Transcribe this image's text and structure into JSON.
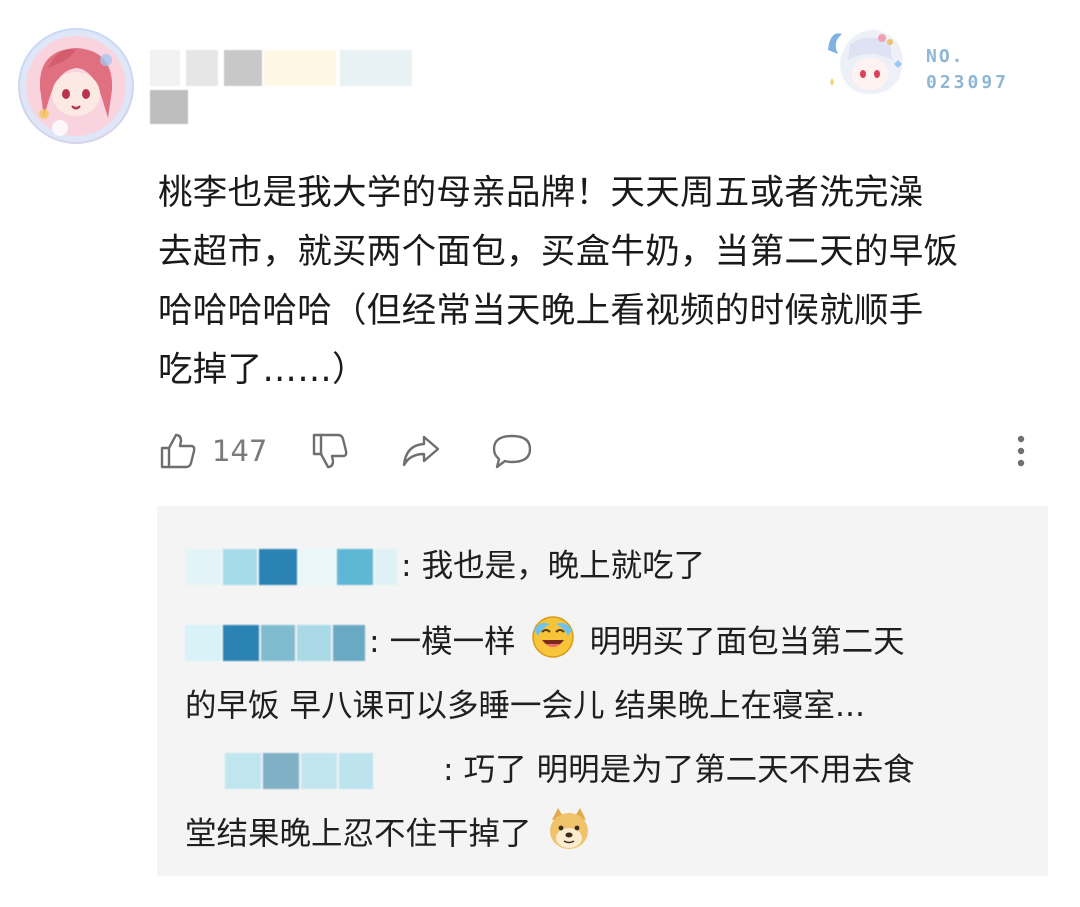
{
  "header": {
    "avatar_icon": "anime-girl-avatar-icon",
    "fan_badge": {
      "label": "NO.",
      "number": "023097",
      "mascot_icon": "chibi-mascot-icon",
      "color": "#8fb6d4"
    }
  },
  "comment": {
    "lines": [
      "桃李也是我大学的母亲品牌！天天周五或者洗完澡",
      "去超市，就买两个面包，买盒牛奶，当第二天的早饭",
      "哈哈哈哈哈（但经常当天晚上看视频的时候就顺手",
      "吃掉了……）"
    ]
  },
  "actions": {
    "like_count": "147",
    "icons": [
      "thumbs-up-icon",
      "thumbs-down-icon",
      "share-icon",
      "comment-icon",
      "more-vertical-icon"
    ]
  },
  "replies": [
    {
      "lines": [
        ": 我也是，晚上就吃了"
      ]
    },
    {
      "line1_before_emoji": ": 一模一样",
      "emoji_icon": "laughing-tears-emoji-icon",
      "line1_after_emoji": "明明买了面包当第二天",
      "line2": "的早饭 早八课可以多睡一会儿 结果晚上在寝室..."
    },
    {
      "line1": ": 巧了 明明是为了第二天不用去食",
      "line2_text": "堂结果晚上忍不住干掉了",
      "emoji_icon": "doge-emoji-icon"
    }
  ],
  "colors": {
    "text": "#1a1a1a",
    "secondary": "#7a7a7a",
    "reply_background": "#f4f4f4",
    "blur_blue": "#2b83b3"
  }
}
